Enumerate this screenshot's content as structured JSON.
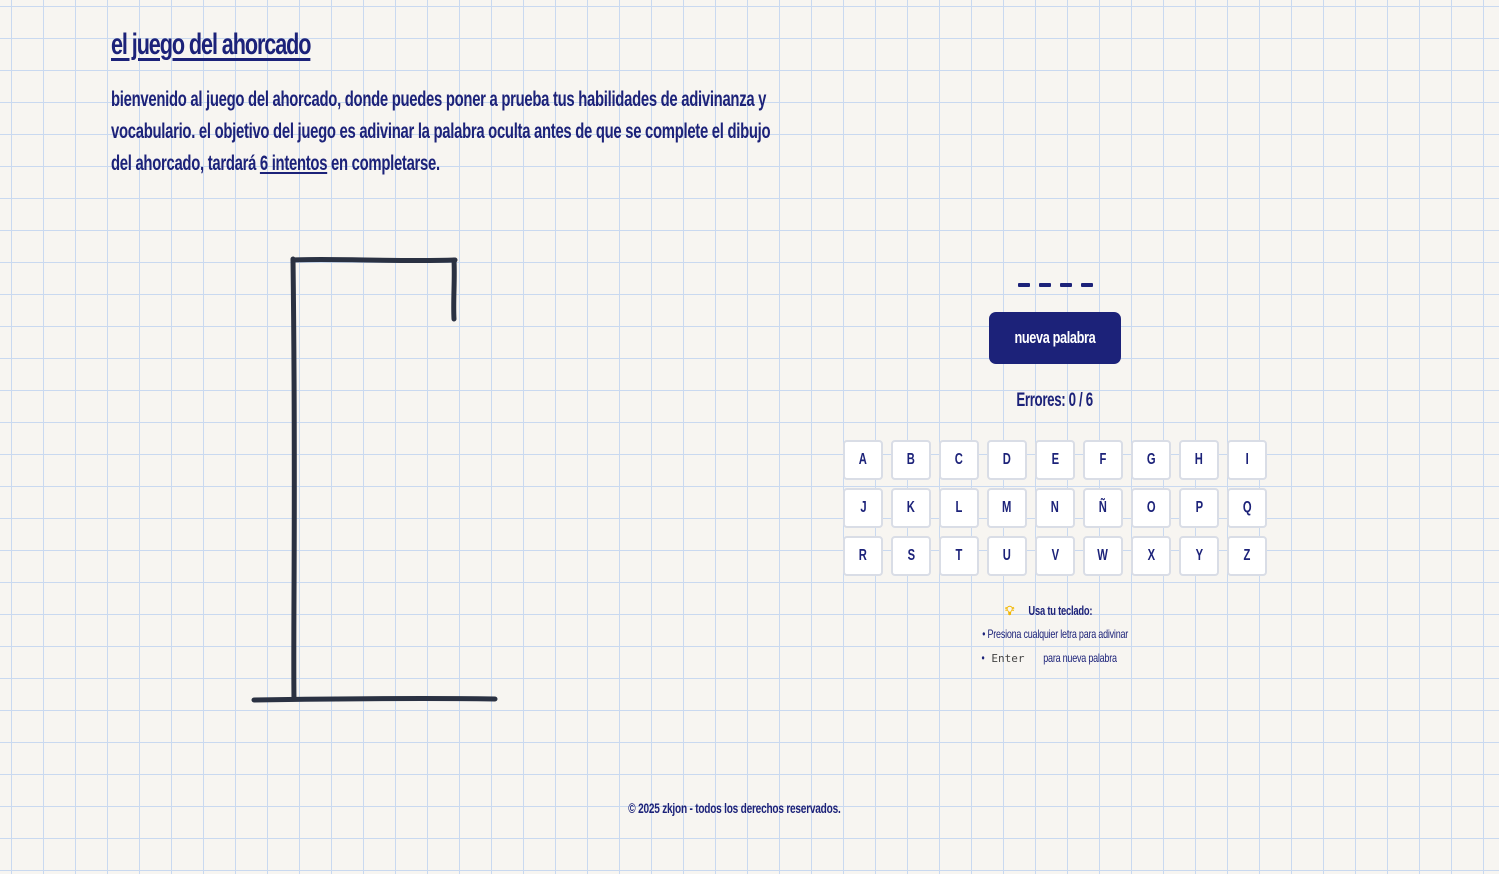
{
  "header": {
    "title": "el juego del ahorcado",
    "intro_before": "bienvenido al juego del ahorcado, donde puedes poner a prueba tus habilidades de adivinanza y vocabulario. el objetivo del juego es adivinar la palabra oculta antes de que se complete el dibujo del ahorcado, tardará ",
    "intro_attempts": "6 intentos",
    "intro_after": " en completarse."
  },
  "game": {
    "word_blanks": [
      "_",
      "_",
      "_",
      "_"
    ],
    "new_word_label": "nueva palabra",
    "errors_label": "Errores: 0 / 6",
    "errors_count": 0,
    "errors_max": 6,
    "keys": [
      "A",
      "B",
      "C",
      "D",
      "E",
      "F",
      "G",
      "H",
      "I",
      "J",
      "K",
      "L",
      "M",
      "N",
      "Ñ",
      "O",
      "P",
      "Q",
      "R",
      "S",
      "T",
      "U",
      "V",
      "W",
      "X",
      "Y",
      "Z"
    ]
  },
  "hints": {
    "title": "Usa tu teclado:",
    "line1": "• Presiona cualquier letra para adivinar",
    "line2_bullet": "•",
    "line2_key": "Enter",
    "line2_text": "para nueva palabra",
    "icon": "lightbulb-icon"
  },
  "footer": {
    "text": "© 2025 zkjon - todos los derechos reservados."
  },
  "colors": {
    "primary": "#1c2279",
    "background": "#f7f5f1",
    "grid": "#c9d9f0",
    "gallows": "#2a3142"
  }
}
